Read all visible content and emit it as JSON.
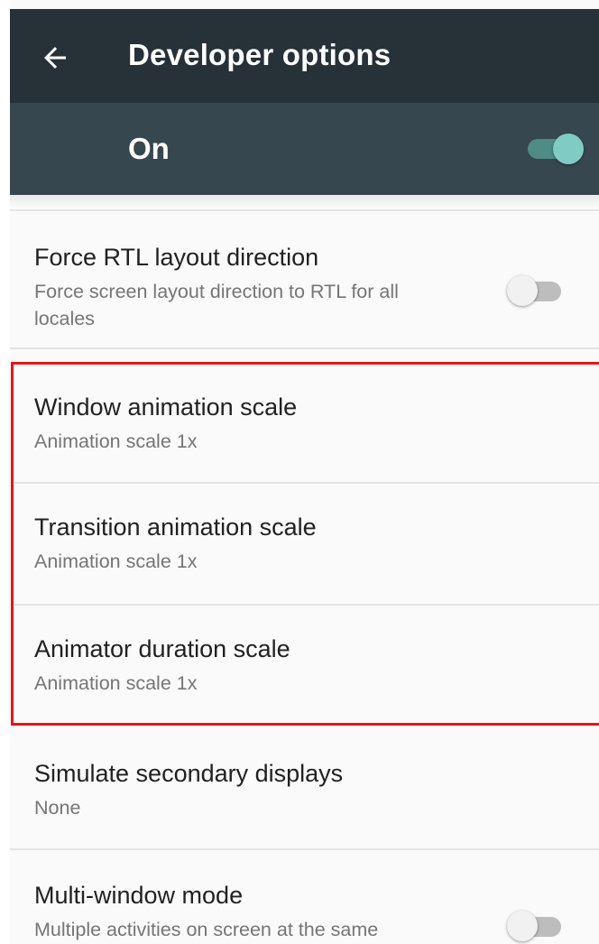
{
  "appbar": {
    "title": "Developer options",
    "back_icon": "arrow-back-icon",
    "background": "#263238"
  },
  "master_switch": {
    "label": "On",
    "state": "on",
    "background": "#37474f",
    "accent": "#80cbc4"
  },
  "settings": [
    {
      "title": "Force RTL layout direction",
      "summary": "Force screen layout direction to RTL for all locales",
      "summary_lines": [
        "Force screen layout direction to RTL for all",
        "locales"
      ],
      "toggle": "off"
    },
    {
      "title": "Window animation scale",
      "summary": "Animation scale 1x"
    },
    {
      "title": "Transition animation scale",
      "summary": "Animation scale 1x"
    },
    {
      "title": "Animator duration scale",
      "summary": "Animation scale 1x"
    },
    {
      "title": "Simulate secondary displays",
      "summary": "None"
    },
    {
      "title": "Multi-window mode",
      "summary": "Multiple activities on screen at the same",
      "toggle": "off"
    }
  ],
  "highlight": {
    "color": "#e8141a",
    "covers": [
      "Window animation scale",
      "Transition animation scale",
      "Animator duration scale"
    ]
  }
}
